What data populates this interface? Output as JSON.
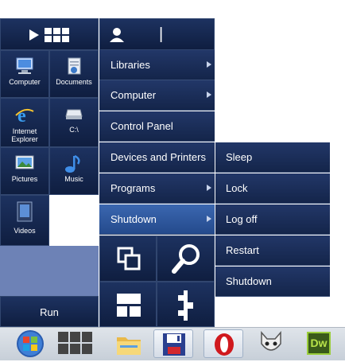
{
  "header": {
    "play_icon": "play-icon",
    "apps_icon": "apps-grid-icon",
    "user_icon": "user-icon",
    "text_cursor": "|"
  },
  "tiles": [
    {
      "label": "Computer",
      "icon": "computer-icon"
    },
    {
      "label": "Documents",
      "icon": "documents-icon"
    },
    {
      "label": "Internet\nExplorer",
      "icon": "internet-explorer-icon"
    },
    {
      "label": "C:\\",
      "icon": "drive-icon"
    },
    {
      "label": "Pictures",
      "icon": "pictures-icon"
    },
    {
      "label": "Music",
      "icon": "music-icon"
    },
    {
      "label": "Videos",
      "icon": "videos-icon"
    }
  ],
  "run_label": "Run",
  "menu": [
    {
      "label": "Libraries",
      "has_submenu": true
    },
    {
      "label": "Computer",
      "has_submenu": true
    },
    {
      "label": "Control Panel",
      "has_submenu": false
    },
    {
      "label": "Devices and Printers",
      "has_submenu": false
    },
    {
      "label": "Programs",
      "has_submenu": true
    },
    {
      "label": "Shutdown",
      "has_submenu": true,
      "active": true
    }
  ],
  "submenu": [
    {
      "label": "Sleep"
    },
    {
      "label": "Lock"
    },
    {
      "label": "Log off"
    },
    {
      "label": "Restart"
    },
    {
      "label": "Shutdown"
    }
  ],
  "quick_tiles": [
    {
      "icon": "switch-windows-icon"
    },
    {
      "icon": "search-icon"
    },
    {
      "icon": "layout-icon"
    },
    {
      "icon": "network-icon"
    }
  ],
  "taskbar": {
    "items": [
      {
        "icon": "windows-orb-icon"
      },
      {
        "icon": "apps-grid-icon"
      },
      {
        "icon": "file-explorer-icon"
      },
      {
        "icon": "save-disk-icon"
      },
      {
        "icon": "opera-icon"
      },
      {
        "icon": "foobar-icon"
      },
      {
        "icon": "dreamweaver-icon",
        "label": "Dw"
      }
    ]
  },
  "colors": {
    "tile_bg": "#14254a",
    "active_item": "#2f5ba3",
    "desktop_gap": "#6d82b6",
    "taskbar": "#d3d9e0"
  }
}
